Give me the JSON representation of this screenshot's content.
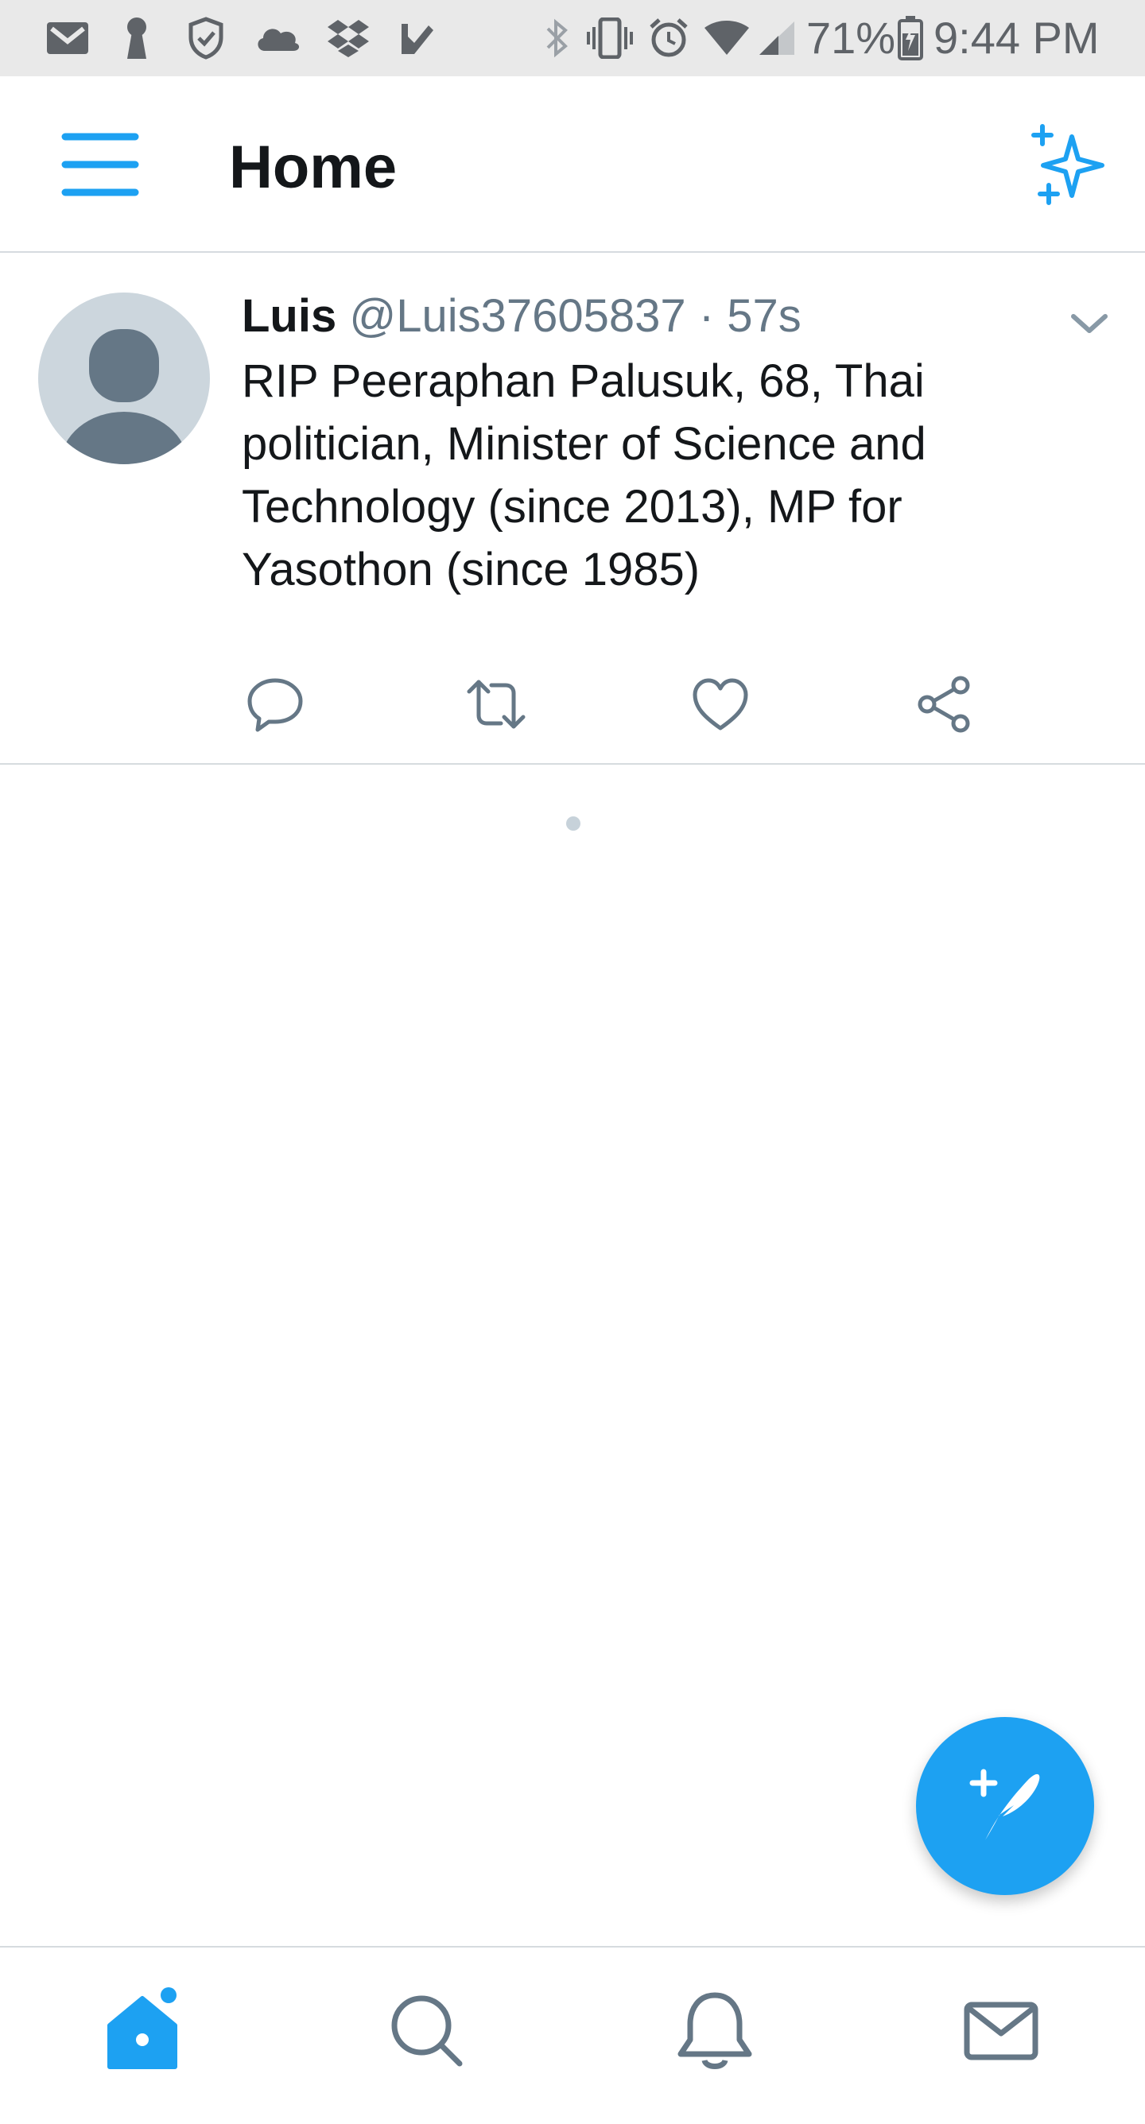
{
  "status_bar": {
    "battery": "71%",
    "time": "9:44 PM",
    "left_icons": [
      "gmail-icon",
      "keyhole-icon",
      "shield-icon",
      "cloud-icon",
      "dropbox-icon",
      "tasks-check-icon"
    ],
    "right_icons": [
      "bluetooth-icon",
      "vibrate-icon",
      "alarm-icon",
      "wifi-icon",
      "cell-signal-icon",
      "battery-charging-icon"
    ]
  },
  "header": {
    "title": "Home",
    "menu_icon": "hamburger-menu-icon",
    "sparkle_icon": "sparkle-icon"
  },
  "tweet": {
    "name": "Luis",
    "handle": "@Luis37605837",
    "separator": "·",
    "time": "57s",
    "text": "RIP Peeraphan Palusuk, 68, Thai politician, Minister of Science and Technology (since 2013), MP for Yasothon (since 1985)",
    "actions": [
      "reply-icon",
      "retweet-icon",
      "like-icon",
      "share-icon"
    ]
  },
  "fab": {
    "icon": "compose-tweet-icon"
  },
  "bottom_nav": {
    "items": [
      "home-icon",
      "search-icon",
      "notifications-icon",
      "messages-icon"
    ],
    "active": "home-icon"
  },
  "colors": {
    "accent": "#1da1f2",
    "text_primary": "#14171a",
    "text_secondary": "#657786",
    "divider": "#d6dbdf",
    "status_bar_bg": "#e9e9e9"
  }
}
